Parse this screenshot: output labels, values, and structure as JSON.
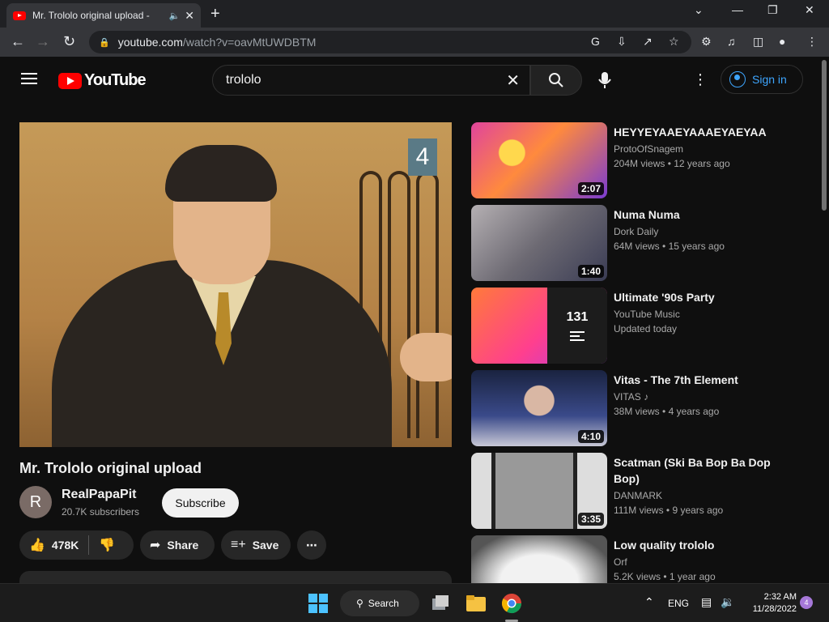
{
  "browser": {
    "tab_title": "Mr. Trololo original upload -",
    "url_host": "youtube.com",
    "url_path": "/watch?v=oavMtUWDBTM"
  },
  "masthead": {
    "logo_text": "YouTube",
    "search_value": "trololo",
    "signin_label": "Sign in"
  },
  "video": {
    "title": "Mr. Trololo original upload",
    "channel_initial": "R",
    "channel_name": "RealPapaPit",
    "subscribers": "20.7K subscribers",
    "subscribe_label": "Subscribe",
    "likes": "478K",
    "share_label": "Share",
    "save_label": "Save"
  },
  "recommendations": [
    {
      "title": "HEYYEYAAEYAAAEYAEYAA",
      "channel": "ProtoOfSnagem",
      "views": "204M views",
      "age": "12 years ago",
      "duration": "2:07"
    },
    {
      "title": "Numa Numa",
      "channel": "Dork Daily",
      "views": "64M views",
      "age": "15 years ago",
      "duration": "1:40"
    },
    {
      "title": "Ultimate '90s Party",
      "channel": "YouTube Music",
      "updated": "Updated today",
      "count": "131"
    },
    {
      "title": "Vitas - The 7th Element",
      "channel": "VITAS",
      "views": "38M views",
      "age": "4 years ago",
      "duration": "4:10"
    },
    {
      "title": "Scatman (Ski Ba Bop Ba Dop Bop)",
      "channel": "DANMARK",
      "views": "111M views",
      "age": "9 years ago",
      "duration": "3:35"
    },
    {
      "title": "Low quality trololo",
      "channel": "Orf",
      "views": "5.2K views",
      "age": "1 year ago"
    }
  ],
  "taskbar": {
    "search_label": "Search",
    "lang": "ENG",
    "time": "2:32 AM",
    "date": "11/28/2022",
    "notifications": "4"
  },
  "colors": {
    "youtube_red": "#ff0000",
    "link_blue": "#3ea6ff",
    "background": "#0f0f0f"
  }
}
